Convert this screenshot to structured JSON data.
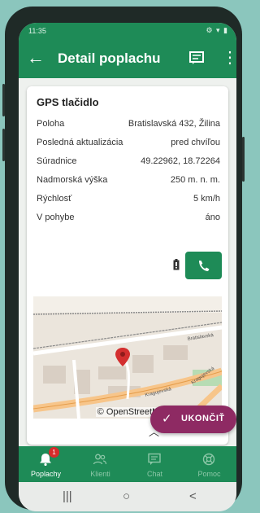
{
  "status_bar": {
    "time": "11:35",
    "icons": "⚙ ▾ ▮"
  },
  "app_bar": {
    "title": "Detail poplachu",
    "back_icon": "arrow-left-icon",
    "notes_icon": "notes-icon",
    "more_icon": "more-vert-icon"
  },
  "detail": {
    "title": "GPS tlačidlo",
    "rows": [
      {
        "label": "Poloha",
        "value": "Bratislavská 432, Žilina"
      },
      {
        "label": "Posledná aktualizácia",
        "value": "pred chvíľou"
      },
      {
        "label": "Súradnice",
        "value": "49.22962, 18.72264"
      },
      {
        "label": "Nadmorská výška",
        "value": "250 m. n. m."
      },
      {
        "label": "Rýchlosť",
        "value": "5 km/h"
      },
      {
        "label": "V pohybe",
        "value": "áno"
      }
    ]
  },
  "map": {
    "attribution": "© OpenStreetMap contributors",
    "street_labels": [
      "Bratislavská",
      "Kragujevská",
      "Kragujevská"
    ]
  },
  "fab": {
    "label": "UKONČIŤ"
  },
  "bottom_nav": [
    {
      "label": "Poplachy",
      "badge": "1",
      "active": true
    },
    {
      "label": "Klienti"
    },
    {
      "label": "Chat"
    },
    {
      "label": "Pomoc"
    }
  ],
  "system_nav": {
    "recents": "|||",
    "home": "○",
    "back": "<"
  },
  "colors": {
    "primary": "#1e8b57",
    "fab": "#8e2a63",
    "badge": "#d62b2b",
    "background": "#8bc6bd"
  }
}
